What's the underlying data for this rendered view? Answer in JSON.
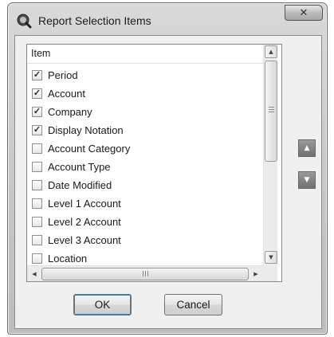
{
  "window": {
    "title": "Report Selection Items",
    "close_label": "✕",
    "app_icon": "magnifier-icon"
  },
  "list": {
    "header": "Item",
    "items": [
      {
        "label": "Period",
        "checked": true
      },
      {
        "label": "Account",
        "checked": true
      },
      {
        "label": "Company",
        "checked": true
      },
      {
        "label": "Display Notation",
        "checked": true
      },
      {
        "label": "Account Category",
        "checked": false
      },
      {
        "label": "Account Type",
        "checked": false
      },
      {
        "label": "Date Modified",
        "checked": false
      },
      {
        "label": "Level 1 Account",
        "checked": false
      },
      {
        "label": "Level 2 Account",
        "checked": false
      },
      {
        "label": "Level 3 Account",
        "checked": false
      },
      {
        "label": "Location",
        "checked": false
      }
    ],
    "check_glyph": "✓"
  },
  "scroll": {
    "up_glyph": "▲",
    "down_glyph": "▼",
    "left_glyph": "◀",
    "right_glyph": "▶"
  },
  "side_buttons": {
    "move_up_glyph": "▲",
    "move_down_glyph": "▼"
  },
  "buttons": {
    "ok": "OK",
    "cancel": "Cancel"
  }
}
